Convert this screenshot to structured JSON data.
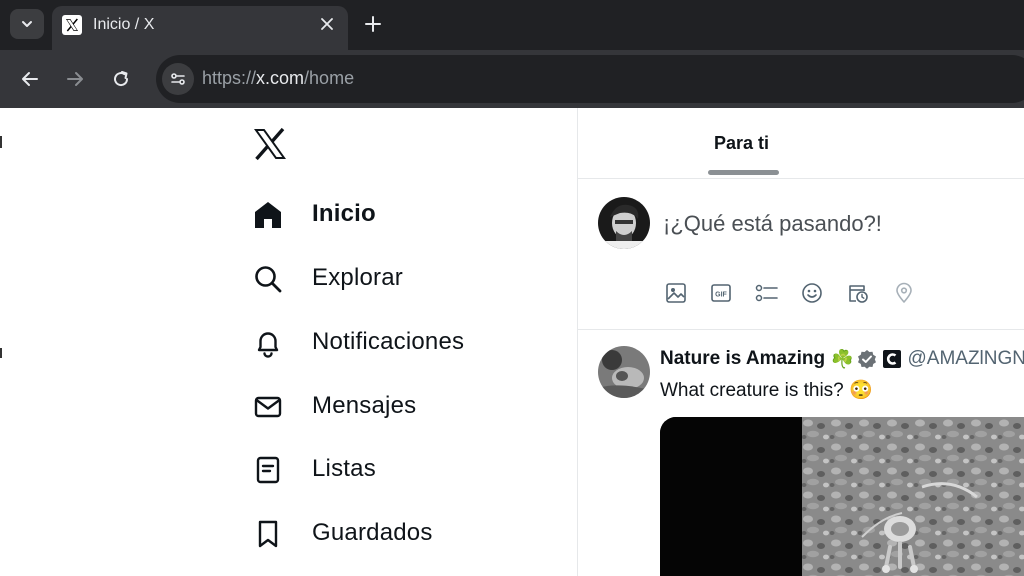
{
  "browser": {
    "tab_title": "Inicio / X",
    "url_scheme": "https://",
    "url_host": "x.com",
    "url_path": "/home",
    "icons": [
      "chevron-down-icon",
      "x-favicon-icon",
      "close-icon",
      "plus-icon",
      "back-icon",
      "forward-icon",
      "reload-icon",
      "site-settings-icon"
    ]
  },
  "sidebar": {
    "items": [
      {
        "label": "Inicio",
        "icon": "home-icon",
        "active": true
      },
      {
        "label": "Explorar",
        "icon": "search-icon",
        "active": false
      },
      {
        "label": "Notificaciones",
        "icon": "bell-icon",
        "active": false
      },
      {
        "label": "Mensajes",
        "icon": "mail-icon",
        "active": false
      },
      {
        "label": "Listas",
        "icon": "list-icon",
        "active": false
      },
      {
        "label": "Guardados",
        "icon": "bookmark-icon",
        "active": false
      }
    ]
  },
  "feed": {
    "tab_label": "Para ti"
  },
  "composer": {
    "placeholder": "¡¿Qué está pasando?!",
    "tools": [
      "image-icon",
      "gif-icon",
      "poll-icon",
      "emoji-icon",
      "schedule-icon",
      "location-icon"
    ]
  },
  "tweet": {
    "author": "Nature is Amazing",
    "emoji": "☘️",
    "handle": "@AMAZlNGN",
    "text": "What creature is this? 😳"
  }
}
